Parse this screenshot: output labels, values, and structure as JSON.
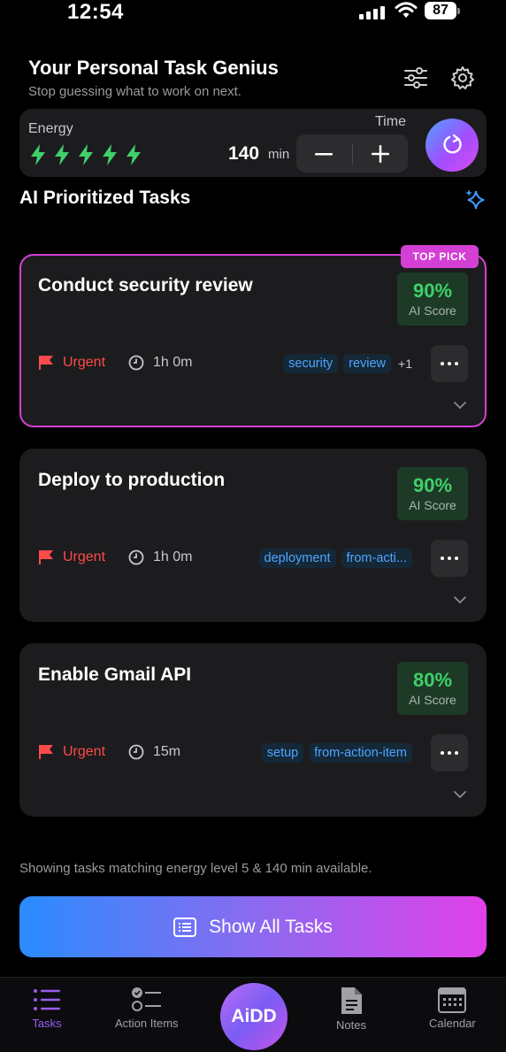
{
  "status": {
    "time": "12:54",
    "battery": "87"
  },
  "header": {
    "title": "Your Personal Task Genius",
    "subtitle": "Stop guessing what to work on next."
  },
  "energy": {
    "label": "Energy",
    "level": 5,
    "max": 5,
    "bolt_color": "#3fd06a",
    "time_label": "Time",
    "time_value": "140",
    "time_unit": "min"
  },
  "section": {
    "title": "AI Prioritized Tasks"
  },
  "top_pick_badge": "TOP PICK",
  "tasks": [
    {
      "title": "Conduct security review",
      "score": "90%",
      "score_label": "AI Score",
      "priority": "Urgent",
      "duration": "1h 0m",
      "tags": [
        "security",
        "review"
      ],
      "more_tags": "+1"
    },
    {
      "title": "Deploy to production",
      "score": "90%",
      "score_label": "AI Score",
      "priority": "Urgent",
      "duration": "1h 0m",
      "tags": [
        "deployment",
        "from-acti..."
      ],
      "more_tags": ""
    },
    {
      "title": "Enable Gmail API",
      "score": "80%",
      "score_label": "AI Score",
      "priority": "Urgent",
      "duration": "15m",
      "tags": [
        "setup",
        "from-action-item"
      ],
      "more_tags": ""
    }
  ],
  "footer_note": "Showing tasks matching energy level 5 & 140 min available.",
  "show_all_label": "Show All Tasks",
  "tabbar": {
    "tasks": "Tasks",
    "action_items": "Action Items",
    "center": "AiDD",
    "notes": "Notes",
    "calendar": "Calendar"
  },
  "colors": {
    "accent": "#d43fd4",
    "urgent": "#ff4a4a",
    "score": "#3fd06a",
    "tag": "#4fa5ff",
    "active_tab": "#9b5cf0"
  }
}
